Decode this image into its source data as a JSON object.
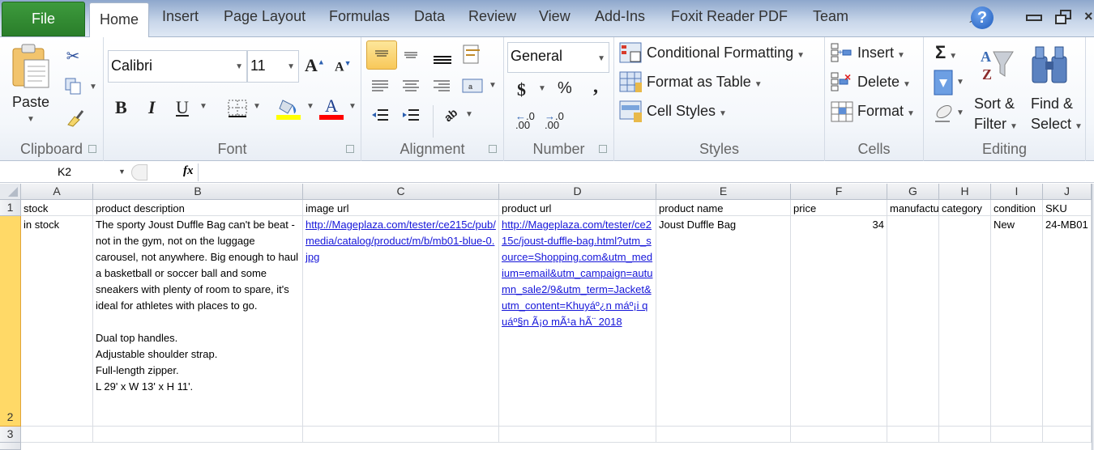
{
  "tabs": {
    "file": "File",
    "items": [
      "Home",
      "Insert",
      "Page Layout",
      "Formulas",
      "Data",
      "Review",
      "View",
      "Add-Ins",
      "Foxit Reader PDF",
      "Team"
    ],
    "active": "Home"
  },
  "window_controls": {
    "collapse": "^",
    "help": "?",
    "minimize": "▭",
    "restore": "❐"
  },
  "ribbon": {
    "clipboard": {
      "label": "Clipboard",
      "paste": "Paste"
    },
    "font": {
      "label": "Font",
      "font_name": "Calibri",
      "font_size": "11",
      "bold": "B",
      "italic": "I",
      "underline": "U",
      "grow": "A",
      "shrink": "A",
      "font_color": "A",
      "highlight_color": "#ffff00",
      "text_color": "#ff0000"
    },
    "alignment": {
      "label": "Alignment"
    },
    "number": {
      "label": "Number",
      "format": "General",
      "currency": "$",
      "percent": "%",
      "comma": ",",
      "inc_decimal": ".00",
      "dec_decimal": ".00"
    },
    "styles": {
      "label": "Styles",
      "conditional_formatting": "Conditional Formatting",
      "format_as_table": "Format as Table",
      "cell_styles": "Cell Styles"
    },
    "cells": {
      "label": "Cells",
      "insert": "Insert",
      "delete": "Delete",
      "format": "Format"
    },
    "editing": {
      "label": "Editing",
      "sum": "Σ",
      "sort_filter_1": "Sort &",
      "sort_filter_2": "Filter",
      "find_select_1": "Find &",
      "find_select_2": "Select"
    }
  },
  "formula_bar": {
    "name_box": "K2",
    "fx": "fx",
    "formula": ""
  },
  "sheet": {
    "columns": [
      "A",
      "B",
      "C",
      "D",
      "E",
      "F",
      "G",
      "H",
      "I",
      "J"
    ],
    "rows": [
      "1",
      "2",
      "3"
    ],
    "header_row": [
      "stock",
      "product description",
      "image url",
      "product url",
      "product name",
      "price",
      "manufacturer",
      "category",
      "condition",
      "SKU"
    ],
    "data_row": {
      "stock": "in stock",
      "description": "The sporty Joust Duffle Bag can't be beat - not in the gym, not on the luggage carousel, not anywhere. Big enough to haul a basketball or soccer ball and some sneakers with plenty of room to spare, it's ideal for athletes with places to go.\n\nDual top handles.\nAdjustable shoulder strap.\nFull-length zipper.\nL 29' x W 13' x H 11'.",
      "image_url": "http://Mageplaza.com/tester/ce215c/pub/media/catalog/product/m/b/mb01-blue-0.jpg",
      "product_url": "http://Mageplaza.com/tester/ce215c/joust-duffle-bag.html?utm_source=Shopping.com&utm_medium=email&utm_campaign=autumn_sale2/9&utm_term=Jacket&utm_content=Khuyáº¿n máº¡i quáº§n Ã¡o mÃ¹a hÃ¨ 2018",
      "product_name": "Joust Duffle Bag",
      "price": "34",
      "manufacturer": "",
      "category": "",
      "condition": "New",
      "sku": "24-MB01"
    },
    "selected_cell": "K2"
  }
}
